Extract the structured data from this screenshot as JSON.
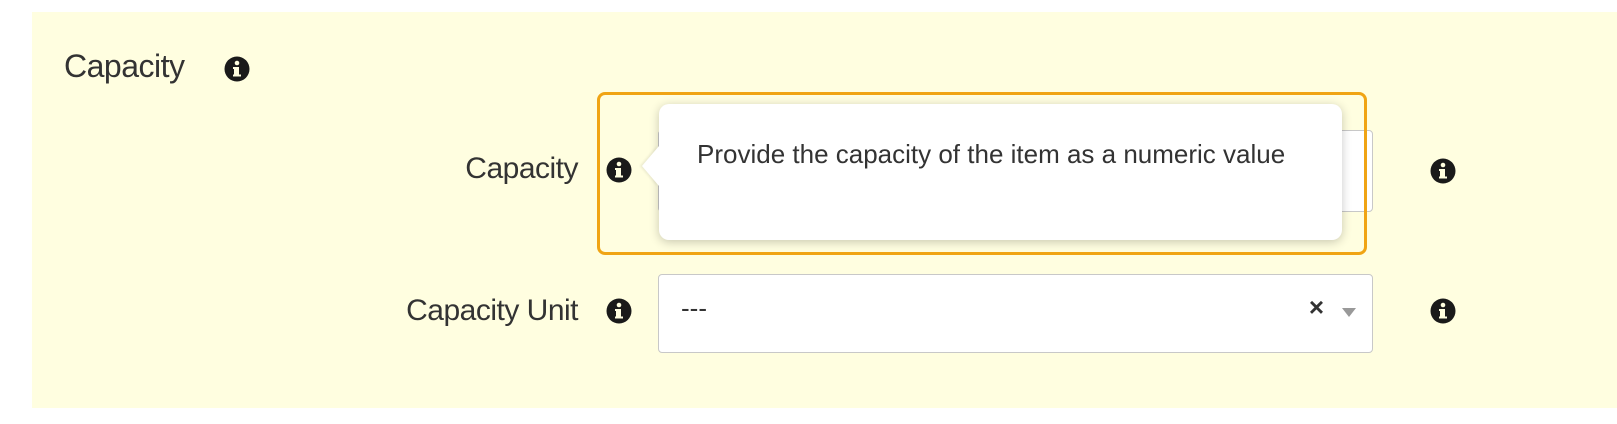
{
  "section": {
    "title": "Capacity",
    "icon": "info-circle-icon"
  },
  "fields": {
    "capacity": {
      "label": "Capacity",
      "value": "",
      "tooltip": "Provide the capacity of the item as a numeric value"
    },
    "capacity_unit": {
      "label": "Capacity Unit",
      "selected": "---",
      "clear_symbol": "×"
    }
  },
  "colors": {
    "panel_bg": "#fffee0",
    "highlight": "#f0a414",
    "text": "#333333"
  }
}
